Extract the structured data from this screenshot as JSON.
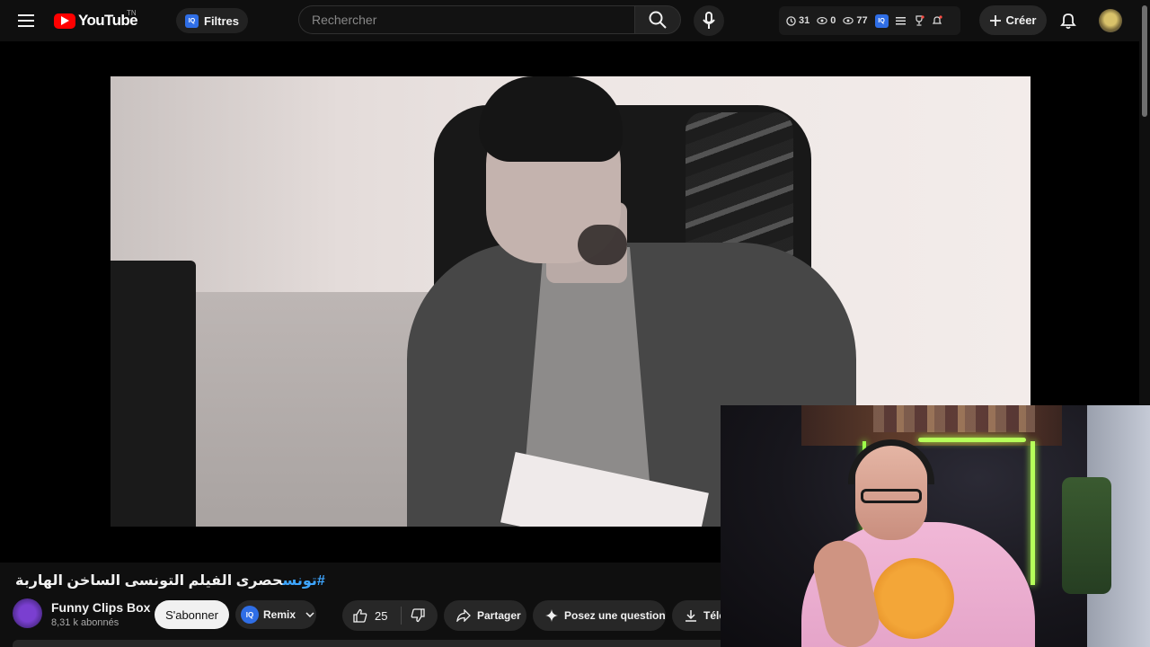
{
  "header": {
    "logo_text": "YouTube",
    "logo_country": "TN",
    "extension_badge": "IQ",
    "filters_label": "Filtres",
    "search_placeholder": "Rechercher",
    "stats": [
      {
        "icon": "clock-icon",
        "value": "31"
      },
      {
        "icon": "eye-icon",
        "value": "0"
      },
      {
        "icon": "eye-icon",
        "value": "77"
      }
    ],
    "create_label": "Créer"
  },
  "video": {
    "title_hashtag": "#تونس",
    "title_text": "حصرى الفيلم التونسى الساخن الهاربة"
  },
  "channel": {
    "name": "Funny Clips Box",
    "subscribers": "8,31 k abonnés",
    "subscribe_label": "S'abonner"
  },
  "actions": {
    "remix_label": "Remix",
    "like_count": "25",
    "share_label": "Partager",
    "ask_label": "Posez une question",
    "download_label": "Télé"
  },
  "colors": {
    "background": "#0f0f0f",
    "brand_red": "#ff0000",
    "link_blue": "#3ea6ff",
    "extension_blue": "#2f6ee6"
  }
}
